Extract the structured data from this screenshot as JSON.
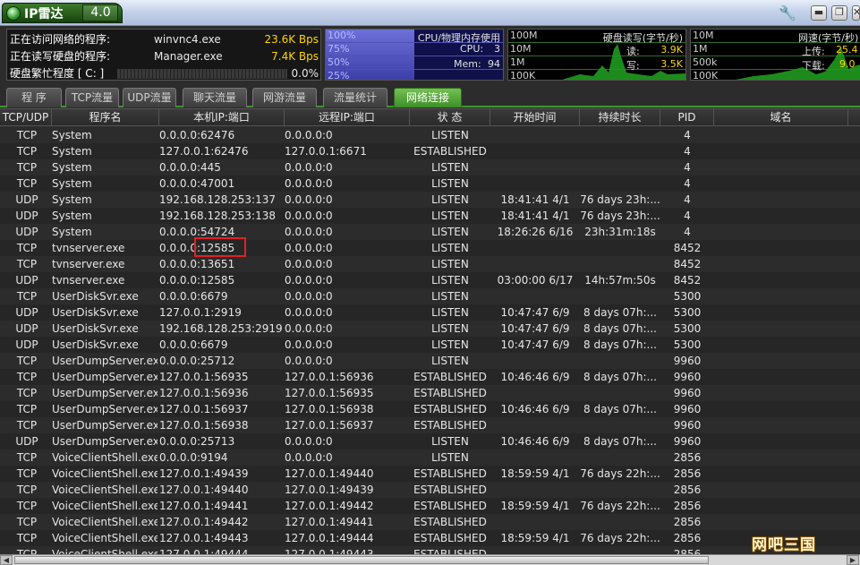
{
  "app": {
    "title": "IP雷达",
    "version": "4.0"
  },
  "window_buttons": {
    "minimize": "▬",
    "restore": "❐",
    "close": "✕",
    "settings_icon": "wrench-icon"
  },
  "info_panel": {
    "net_label": "正在访问网络的程序:",
    "net_program": "winvnc4.exe",
    "net_speed": "23.6K Bps",
    "disk_label": "正在读写硬盘的程序:",
    "disk_program": "Manager.exe",
    "disk_speed": "7.4K Bps",
    "busy_label": "硬盘繁忙程度 [ C: ]",
    "busy_percent": "0.0%",
    "busy_level": 0.0
  },
  "cpu_graph": {
    "title": "CPU/物理内存使用",
    "ticks": [
      "100%",
      "75%",
      "50%",
      "25%"
    ],
    "cpu_label": "CPU:",
    "cpu_value": "3",
    "mem_label": "Mem:",
    "mem_value": "94"
  },
  "disk_graph": {
    "title": "硬盘读写(字节/秒)",
    "ticks": [
      "100M",
      "10M",
      "1M",
      "100K"
    ],
    "read_label": "读:",
    "read_value": "3.9K",
    "write_label": "写:",
    "write_value": "3.5K"
  },
  "net_graph": {
    "title": "网速(字节/秒)",
    "ticks": [
      "10M",
      "1M",
      "500k",
      "100K"
    ],
    "up_label": "上传:",
    "up_value": "25.4",
    "down_label": "下载:",
    "down_value": "9.0"
  },
  "tabs": [
    {
      "label": "程 序"
    },
    {
      "label": "TCP流量"
    },
    {
      "label": "UDP流量"
    },
    {
      "label": "聊天流量"
    },
    {
      "label": "网游流量"
    },
    {
      "label": "流量统计"
    },
    {
      "label": "网络连接"
    }
  ],
  "active_tab": 6,
  "columns": [
    "TCP/UDP",
    "程序名",
    "本机IP:端口",
    "远程IP:端口",
    "状 态",
    "开始时间",
    "持续时长",
    "PID",
    "域名"
  ],
  "rows": [
    [
      "TCP",
      "System",
      "0.0.0.0:62476",
      "0.0.0.0:0",
      "LISTEN",
      "",
      "",
      "4"
    ],
    [
      "TCP",
      "System",
      "127.0.0.1:62476",
      "127.0.0.1:6671",
      "ESTABLISHED",
      "",
      "",
      "4"
    ],
    [
      "TCP",
      "System",
      "0.0.0.0:445",
      "0.0.0.0:0",
      "LISTEN",
      "",
      "",
      "4"
    ],
    [
      "TCP",
      "System",
      "0.0.0.0:47001",
      "0.0.0.0:0",
      "LISTEN",
      "",
      "",
      "4"
    ],
    [
      "UDP",
      "System",
      "192.168.128.253:137",
      "0.0.0.0:0",
      "LISTEN",
      "18:41:41 4/1",
      "76 days 23h:...",
      "4"
    ],
    [
      "UDP",
      "System",
      "192.168.128.253:138",
      "0.0.0.0:0",
      "LISTEN",
      "18:41:41 4/1",
      "76 days 23h:...",
      "4"
    ],
    [
      "UDP",
      "System",
      "0.0.0.0:54724",
      "0.0.0.0:0",
      "LISTEN",
      "18:26:26 6/16",
      "23h:31m:18s",
      "4"
    ],
    [
      "TCP",
      "tvnserver.exe",
      "0.0.0.0:12585",
      "0.0.0.0:0",
      "LISTEN",
      "",
      "",
      "8452"
    ],
    [
      "TCP",
      "tvnserver.exe",
      "0.0.0.0:13651",
      "0.0.0.0:0",
      "LISTEN",
      "",
      "",
      "8452"
    ],
    [
      "UDP",
      "tvnserver.exe",
      "0.0.0.0:12585",
      "0.0.0.0:0",
      "LISTEN",
      "03:00:00 6/17",
      "14h:57m:50s",
      "8452"
    ],
    [
      "TCP",
      "UserDiskSvr.exe",
      "0.0.0.0:6679",
      "0.0.0.0:0",
      "LISTEN",
      "",
      "",
      "5300"
    ],
    [
      "UDP",
      "UserDiskSvr.exe",
      "127.0.0.1:2919",
      "0.0.0.0:0",
      "LISTEN",
      "10:47:47 6/9",
      "8 days 07h:...",
      "5300"
    ],
    [
      "UDP",
      "UserDiskSvr.exe",
      "192.168.128.253:2919",
      "0.0.0.0:0",
      "LISTEN",
      "10:47:47 6/9",
      "8 days 07h:...",
      "5300"
    ],
    [
      "UDP",
      "UserDiskSvr.exe",
      "0.0.0.0:6679",
      "0.0.0.0:0",
      "LISTEN",
      "10:47:47 6/9",
      "8 days 07h:...",
      "5300"
    ],
    [
      "TCP",
      "UserDumpServer.exe",
      "0.0.0.0:25712",
      "0.0.0.0:0",
      "LISTEN",
      "",
      "",
      "9960"
    ],
    [
      "TCP",
      "UserDumpServer.exe",
      "127.0.0.1:56935",
      "127.0.0.1:56936",
      "ESTABLISHED",
      "10:46:46 6/9",
      "8 days 07h:...",
      "9960"
    ],
    [
      "TCP",
      "UserDumpServer.exe",
      "127.0.0.1:56936",
      "127.0.0.1:56935",
      "ESTABLISHED",
      "",
      "",
      "9960"
    ],
    [
      "TCP",
      "UserDumpServer.exe",
      "127.0.0.1:56937",
      "127.0.0.1:56938",
      "ESTABLISHED",
      "10:46:46 6/9",
      "8 days 07h:...",
      "9960"
    ],
    [
      "TCP",
      "UserDumpServer.exe",
      "127.0.0.1:56938",
      "127.0.0.1:56937",
      "ESTABLISHED",
      "",
      "",
      "9960"
    ],
    [
      "UDP",
      "UserDumpServer.exe",
      "0.0.0.0:25713",
      "0.0.0.0:0",
      "LISTEN",
      "10:46:46 6/9",
      "8 days 07h:...",
      "9960"
    ],
    [
      "TCP",
      "VoiceClientShell.exe",
      "0.0.0.0:9194",
      "0.0.0.0:0",
      "LISTEN",
      "",
      "",
      "2856"
    ],
    [
      "TCP",
      "VoiceClientShell.exe",
      "127.0.0.1:49439",
      "127.0.0.1:49440",
      "ESTABLISHED",
      "18:59:59 4/1",
      "76 days 22h:...",
      "2856"
    ],
    [
      "TCP",
      "VoiceClientShell.exe",
      "127.0.0.1:49440",
      "127.0.0.1:49439",
      "ESTABLISHED",
      "",
      "",
      "2856"
    ],
    [
      "TCP",
      "VoiceClientShell.exe",
      "127.0.0.1:49441",
      "127.0.0.1:49442",
      "ESTABLISHED",
      "18:59:59 4/1",
      "76 days 22h:...",
      "2856"
    ],
    [
      "TCP",
      "VoiceClientShell.exe",
      "127.0.0.1:49442",
      "127.0.0.1:49441",
      "ESTABLISHED",
      "",
      "",
      "2856"
    ],
    [
      "TCP",
      "VoiceClientShell.exe",
      "127.0.0.1:49443",
      "127.0.0.1:49444",
      "ESTABLISHED",
      "18:59:59 4/1",
      "76 days 22h:...",
      "2856"
    ],
    [
      "TCP",
      "VoiceClientShell.exe",
      "127.0.0.1:49444",
      "127.0.0.1:49443",
      "ESTABLISHED",
      "",
      "",
      "2856"
    ]
  ],
  "watermark": "网吧三国"
}
